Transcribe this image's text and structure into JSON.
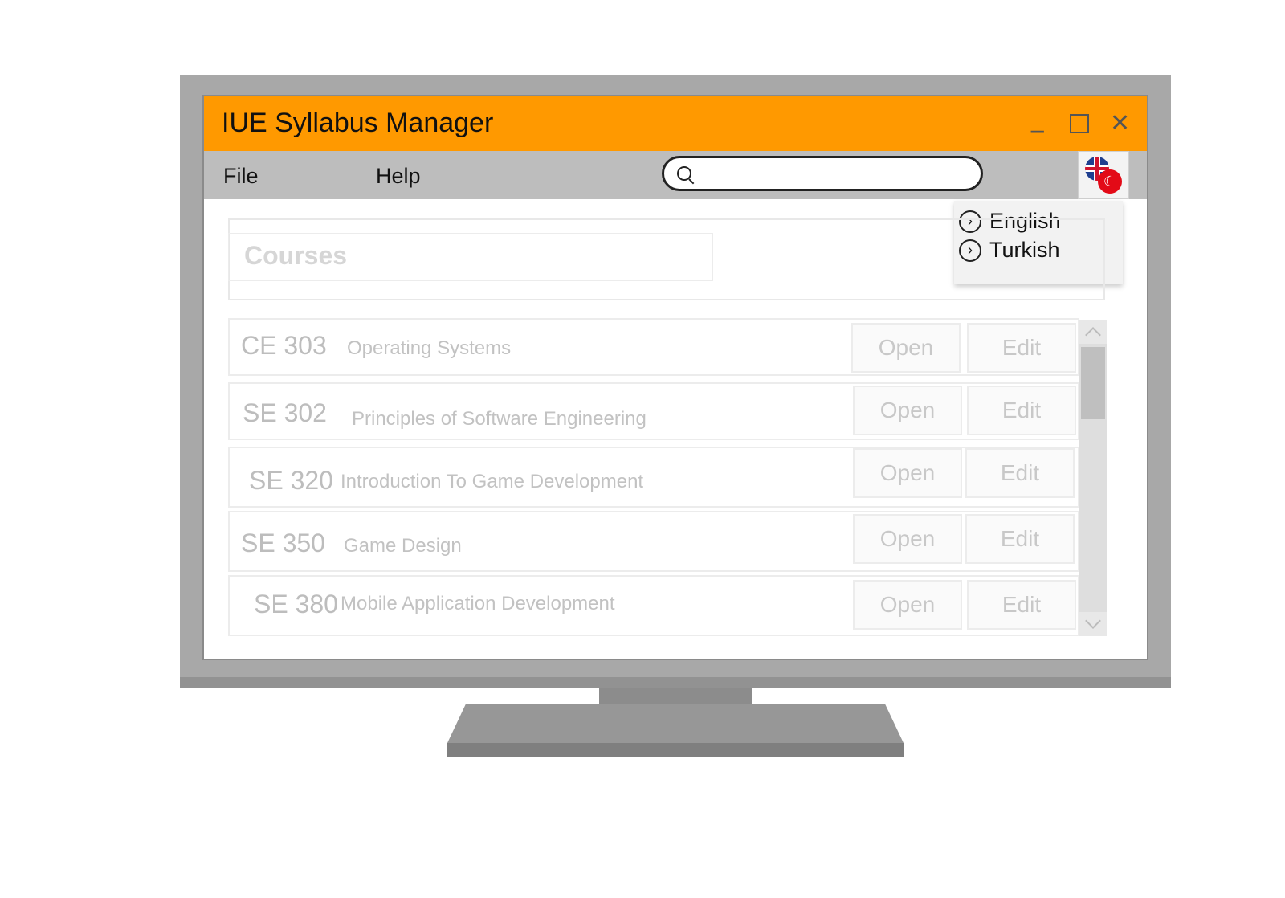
{
  "window": {
    "title": "IUE Syllabus Manager",
    "minimize_label": "_",
    "close_label": "✕"
  },
  "menu": {
    "file_label": "File",
    "help_label": "Help"
  },
  "search": {
    "value": "",
    "placeholder": ""
  },
  "language": {
    "options": [
      {
        "label": "English"
      },
      {
        "label": "Turkish"
      }
    ]
  },
  "courses_title": "Courses",
  "courses": [
    {
      "code": "CE 303",
      "name": "Operating Systems",
      "open_label": "Open",
      "edit_label": "Edit"
    },
    {
      "code": "SE 302",
      "name": "Principles of Software Engineering",
      "open_label": "Open",
      "edit_label": "Edit"
    },
    {
      "code": "SE 320",
      "name": "Introduction To Game Development",
      "open_label": "Open",
      "edit_label": "Edit"
    },
    {
      "code": "SE 350",
      "name": "Game Design",
      "open_label": "Open",
      "edit_label": "Edit"
    },
    {
      "code": "SE 380",
      "name": "Mobile Application Development",
      "open_label": "Open",
      "edit_label": "Edit"
    }
  ],
  "colors": {
    "titlebar": "#ff9900",
    "menubar": "#bdbdbd",
    "monitor": "#a8a8a8"
  }
}
